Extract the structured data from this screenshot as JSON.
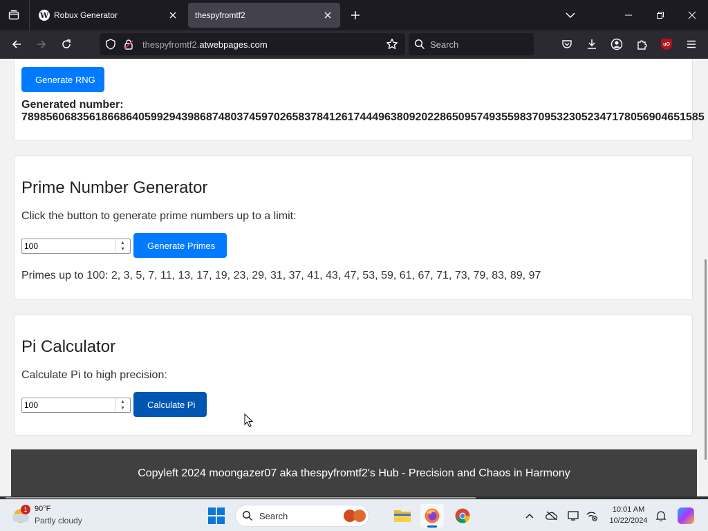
{
  "browser": {
    "tabs": [
      {
        "title": "Robux Generator",
        "active": false,
        "favicon": "wordpress-icon"
      },
      {
        "title": "thespyfromtf2",
        "active": true
      }
    ],
    "url_host": "thespyfromtf2.atwebpages.com",
    "url_prefix": "thespyfromtf2.",
    "url_domain": "atwebpages.com",
    "search_placeholder": "Search"
  },
  "rng_section": {
    "button_label": "Generate RNG",
    "result_label": "Generated number:",
    "result_value": "789856068356186686405992943986874803745970265837841261744496380920228650957493559837095323052347178056904651585"
  },
  "prime_section": {
    "title": "Prime Number Generator",
    "description": "Click the button to generate prime numbers up to a limit:",
    "input_value": "100",
    "button_label": "Generate Primes",
    "result": "Primes up to 100: 2, 3, 5, 7, 11, 13, 17, 19, 23, 29, 31, 37, 41, 43, 47, 53, 59, 61, 67, 71, 73, 79, 83, 89, 97"
  },
  "pi_section": {
    "title": "Pi Calculator",
    "description": "Calculate Pi to high precision:",
    "input_value": "100",
    "button_label": "Calculate Pi"
  },
  "footer": {
    "text": "Copyleft 2024 moongazer07 aka thespyfromtf2's Hub - Precision and Chaos in Harmony"
  },
  "taskbar": {
    "weather_temp": "90°F",
    "weather_condition": "Partly cloudy",
    "weather_badge": "1",
    "search_placeholder": "Search",
    "time": "10:01 AM",
    "date": "10/22/2024"
  },
  "colors": {
    "primary_button": "#007bff",
    "primary_button_pressed": "#0056b3",
    "footer_bg": "#404040",
    "browser_tabbar": "#1c1b22",
    "browser_toolbar": "#2b2a33"
  }
}
